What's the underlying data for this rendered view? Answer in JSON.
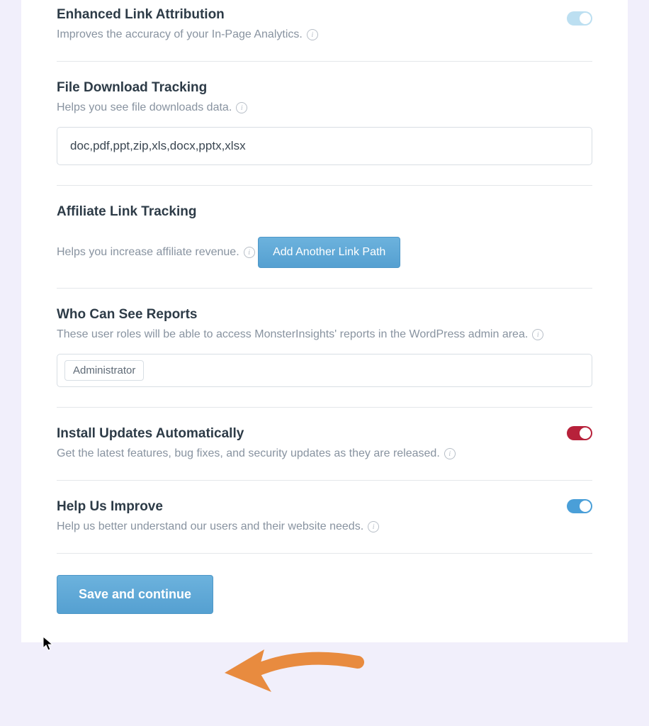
{
  "sections": {
    "enhanced": {
      "title": "Enhanced Link Attribution",
      "desc": "Improves the accuracy of your In-Page Analytics."
    },
    "download": {
      "title": "File Download Tracking",
      "desc": "Helps you see file downloads data.",
      "value": "doc,pdf,ppt,zip,xls,docx,pptx,xlsx"
    },
    "affiliate": {
      "title": "Affiliate Link Tracking",
      "desc": "Helps you increase affiliate revenue.",
      "button": "Add Another Link Path"
    },
    "reports": {
      "title": "Who Can See Reports",
      "desc": "These user roles will be able to access MonsterInsights' reports in the WordPress admin area.",
      "tag": "Administrator"
    },
    "updates": {
      "title": "Install Updates Automatically",
      "desc": "Get the latest features, bug fixes, and security updates as they are released."
    },
    "improve": {
      "title": "Help Us Improve",
      "desc": "Help us better understand our users and their website needs."
    }
  },
  "footer": {
    "save": "Save and continue"
  }
}
